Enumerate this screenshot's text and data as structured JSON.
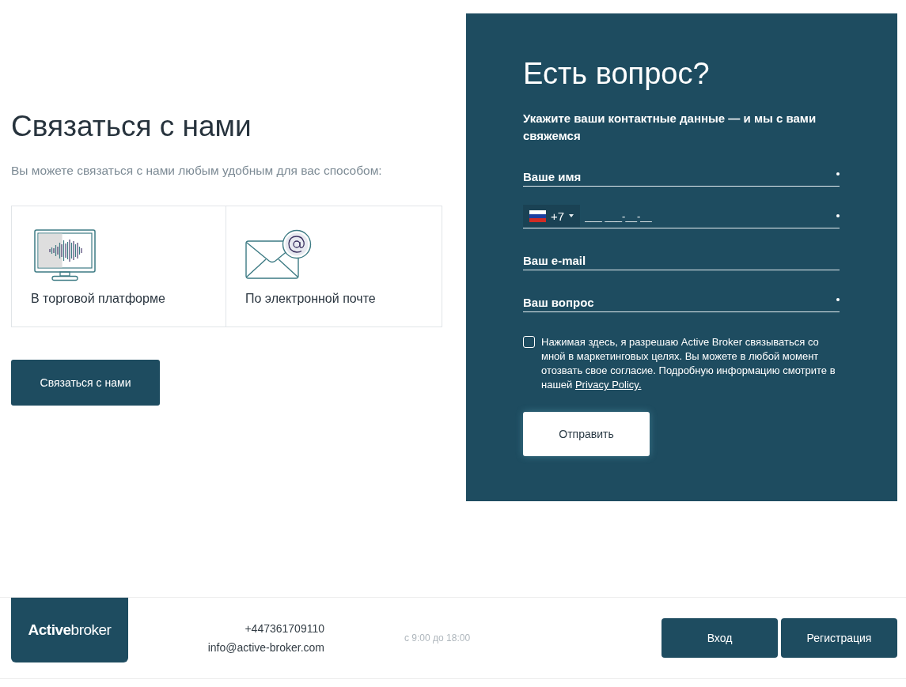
{
  "contact": {
    "title": "Связаться с нами",
    "subtitle": "Вы можете связаться с нами любым удобным для вас способом:",
    "methods": [
      {
        "kind": "platform",
        "label": "В торговой платформе"
      },
      {
        "kind": "email",
        "label": "По электронной почте"
      }
    ],
    "button": "Связаться с нами"
  },
  "question_form": {
    "title": "Есть вопрос?",
    "subtitle": "Укажите ваши контактные данные — и мы с вами свяжемся",
    "fields": [
      {
        "kind": "text",
        "placeholder": "Ваше имя",
        "required": true
      },
      {
        "kind": "phone",
        "code": "+7",
        "placeholder": "___ ___-__-__",
        "required": true
      },
      {
        "kind": "text",
        "placeholder": "Ваш e-mail",
        "required": false
      },
      {
        "kind": "text",
        "placeholder": "Ваш вопрос",
        "required": true
      }
    ],
    "consent": {
      "checked": false,
      "text": "Нажимая здесь, я разрешаю Active Broker связываться со мной в маркетинговых целях. Вы можете в любой момент отозвать свое согласие. Подробную информацию смотрите в нашей",
      "link": "Privacy Policy."
    },
    "submit": "Отправить"
  },
  "footer": {
    "logo": "**Active**broker",
    "phone": "+447361709110",
    "email": "info@active-broker.com",
    "hours": "с 9:00 до 18:00",
    "buttons": [
      "Вход",
      "Регистрация"
    ]
  }
}
